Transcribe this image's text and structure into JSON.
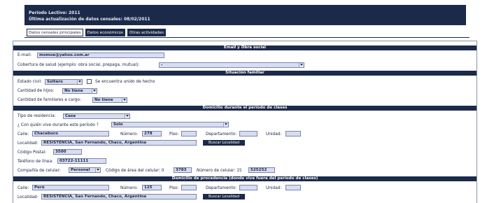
{
  "header": {
    "periodo": "Período Lectivo: 2011",
    "ultima": "Última actualización de datos censales: 08/02/2011"
  },
  "tabs": [
    {
      "label": "Datos censales principales"
    },
    {
      "label": "Datos económicos"
    },
    {
      "label": "Otras actividades"
    }
  ],
  "sections": {
    "email_obra": "Email y Obra social",
    "situacion": "Situación familiar",
    "domicilio_clases": "Domicilio durante el período de clases",
    "domicilio_procedencia": "Domicilio de procedencia (donde vive fuera del período de clases)"
  },
  "email": {
    "label": "E-mail:",
    "value": "momoe@yahoo.com.ar"
  },
  "cobertura": {
    "label": "Cobertura de salud (ejemplo: obra social, prepaga, mutual):",
    "value": "-"
  },
  "estado_civil": {
    "label": "Estado civil:",
    "value": "Soltero",
    "union_label": "Se encuentra unido de hecho"
  },
  "hijos": {
    "label": "Cantidad de hijos:",
    "value": "No tiene"
  },
  "familiares": {
    "label": "Cantidad de familiares a cargo:",
    "value": "No tiene"
  },
  "residencia": {
    "label": "Tipo de residencia:",
    "value": "Casa"
  },
  "convive": {
    "label": "¿ Con quién vive durante este período ?",
    "value": "Solo"
  },
  "clases": {
    "calle_label": "Calle:",
    "calle": "Chacabuco",
    "numero_label": "Número:",
    "numero": "278",
    "piso_label": "Piso:",
    "piso": "",
    "depto_label": "Departamento:",
    "depto": "",
    "unidad_label": "Unidad:",
    "unidad": "",
    "localidad_label": "Localidad:",
    "localidad": "RESISTENCIA, San Fernando, Chaco, Argentina",
    "buscar": "Buscar Localidad",
    "cp_label": "Código Postal:",
    "cp": "3500",
    "tel_label": "Teléfono de línea:",
    "tel": "03722-11111",
    "compania_label": "Compañía de celular:",
    "compania": "Personal",
    "area_label": "Código de área del celular: 0",
    "area": "3783",
    "cel_label": "Número de celular: 15",
    "cel": "525252"
  },
  "procedencia": {
    "calle_label": "Calle:",
    "calle": "Perú",
    "numero_label": "Número:",
    "numero": "125",
    "piso_label": "Piso:",
    "piso": "",
    "depto_label": "Departamento:",
    "depto": "",
    "unidad_label": "Unidad:",
    "unidad": "",
    "localidad_label": "Localidad:",
    "localidad": "RESISTENCIA, San Fernando, Chaco, Argentina",
    "buscar": "Buscar Localidad"
  }
}
